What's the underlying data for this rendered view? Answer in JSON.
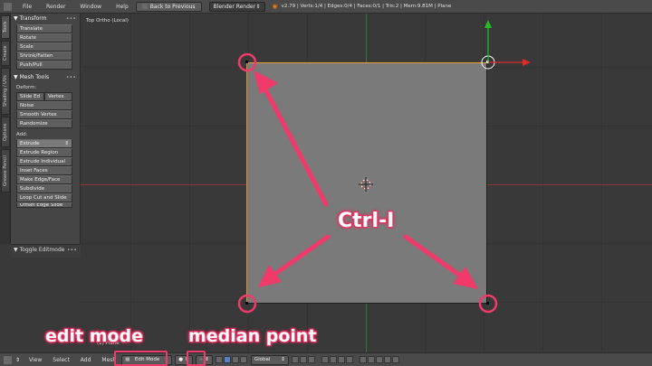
{
  "topbar": {
    "menus": [
      "File",
      "Render",
      "Window",
      "Help"
    ],
    "back_button": "Back to Previous",
    "render_engine": "Blender Render",
    "stats": "v2.79 | Verts:1/4 | Edges:0/4 | Faces:0/1 | Tris:2 | Mem:9.81M | Plane"
  },
  "vtabs": [
    "Tools",
    "Create",
    "Shading / UVs",
    "Options",
    "Grease Pencil"
  ],
  "toolshelf": {
    "transform": {
      "title": "Transform",
      "buttons": [
        "Translate",
        "Rotate",
        "Scale",
        "Shrink/Fatten",
        "Push/Pull"
      ]
    },
    "mesh_tools": {
      "title": "Mesh Tools",
      "deform_label": "Deform:",
      "slide_edge": "Slide Ed",
      "vertex": "Vertex",
      "deform_buttons": [
        "Noise",
        "Smooth Vertex",
        "Randomize"
      ],
      "add_label": "Add:",
      "extrude": "Extrude",
      "add_buttons": [
        "Extrude Region",
        "Extrude Individual",
        "Inset Faces",
        "Make Edge/Face",
        "Subdivide",
        "Loop Cut and Slide",
        "Offset Edge Slide"
      ]
    },
    "operator_panel": "Toggle Editmode"
  },
  "viewport": {
    "label": "Top Ortho (Local)",
    "object_label": "(1) Plane"
  },
  "bottombar": {
    "menus": [
      "View",
      "Select",
      "Add",
      "Mesh"
    ],
    "mode": "Edit Mode",
    "orientation": "Global"
  },
  "annotations": {
    "ctrl_i": "Ctrl-I",
    "edit_mode": "edit mode",
    "median_point": "median point",
    "accent_color": "#f03a6a"
  }
}
